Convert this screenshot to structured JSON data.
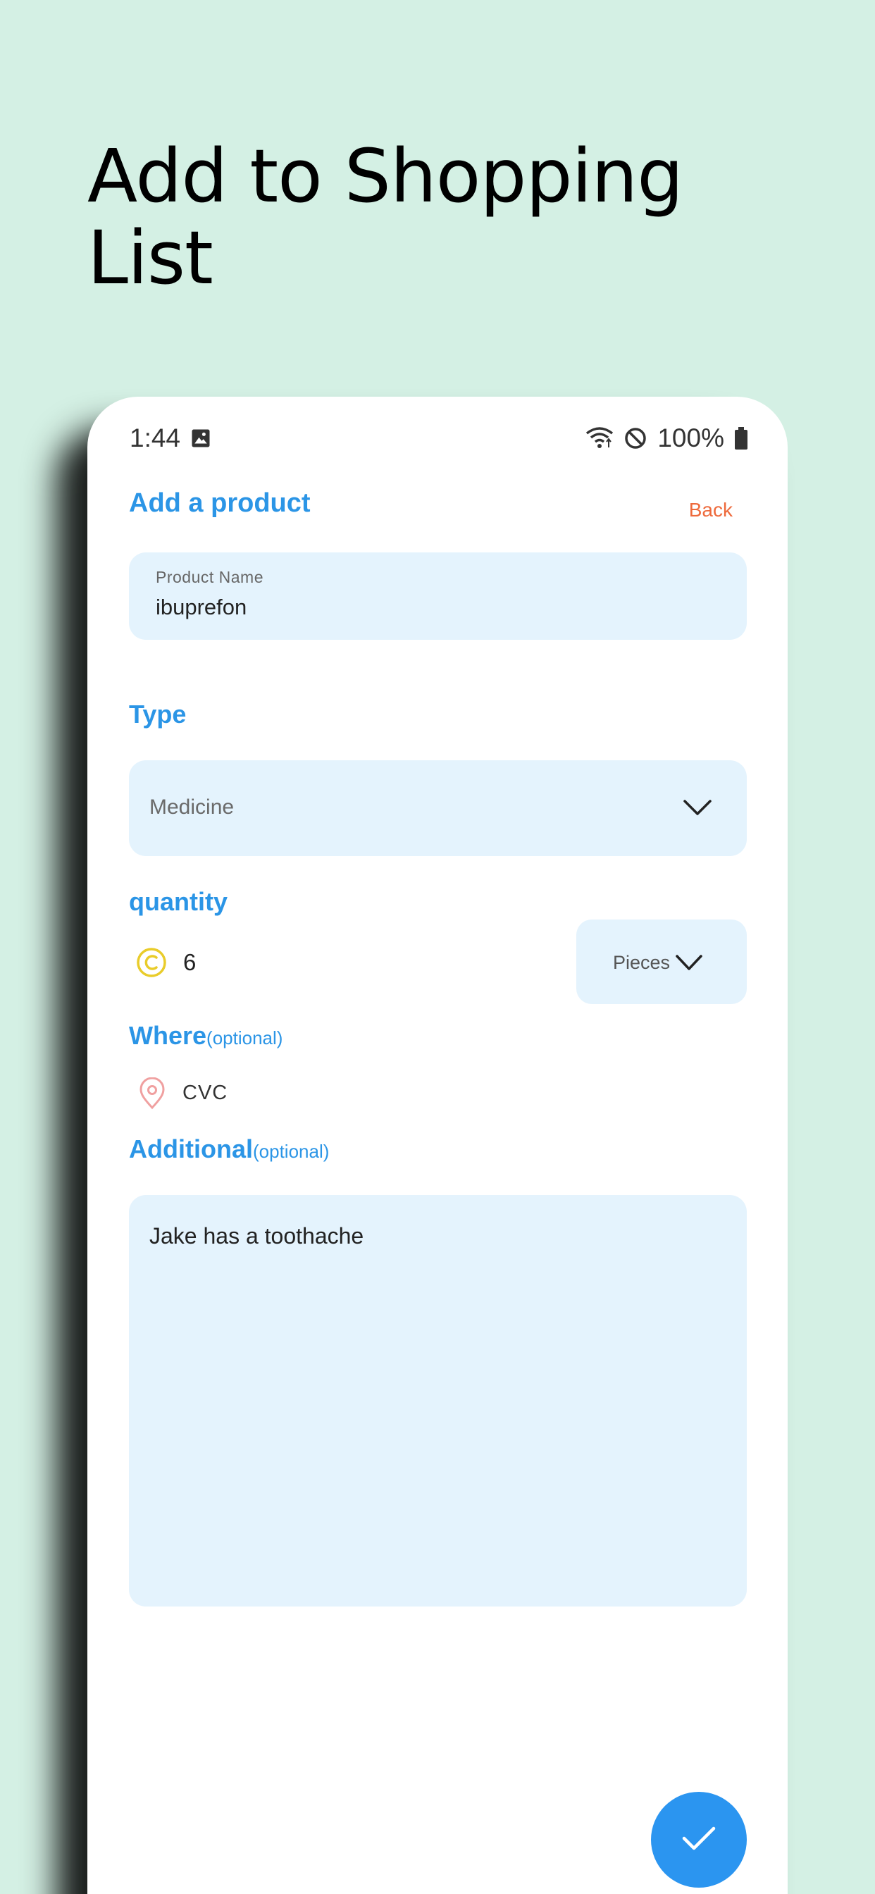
{
  "headline": "Add to Shopping List",
  "status_bar": {
    "time": "1:44",
    "battery": "100%"
  },
  "form": {
    "title": "Add a product",
    "back_label": "Back",
    "product_name": {
      "label": "Product Name",
      "value": "ibuprefon"
    },
    "type": {
      "label": "Type",
      "selected": "Medicine"
    },
    "quantity": {
      "label": "quantity",
      "value": "6",
      "unit": "Pieces"
    },
    "where": {
      "label": "Where",
      "optional": "(optional)",
      "value": "CVC"
    },
    "additional": {
      "label": "Additional",
      "optional": "(optional)",
      "value": "Jake has a toothache"
    }
  },
  "colors": {
    "background": "#d4f0e4",
    "accent": "#2b95e6",
    "back_link": "#ee6a3c",
    "field_bg": "#e4f3fd",
    "fab": "#2b95f0"
  },
  "icons": {
    "gallery": "image-icon",
    "wifi": "wifi-icon",
    "dnd": "do-not-disturb-icon",
    "battery": "battery-icon",
    "type_dropdown": "chevron-down-icon",
    "unit_dropdown": "chevron-down-icon",
    "quantity": "coin-icon",
    "where": "location-pin-icon",
    "submit": "check-icon"
  }
}
